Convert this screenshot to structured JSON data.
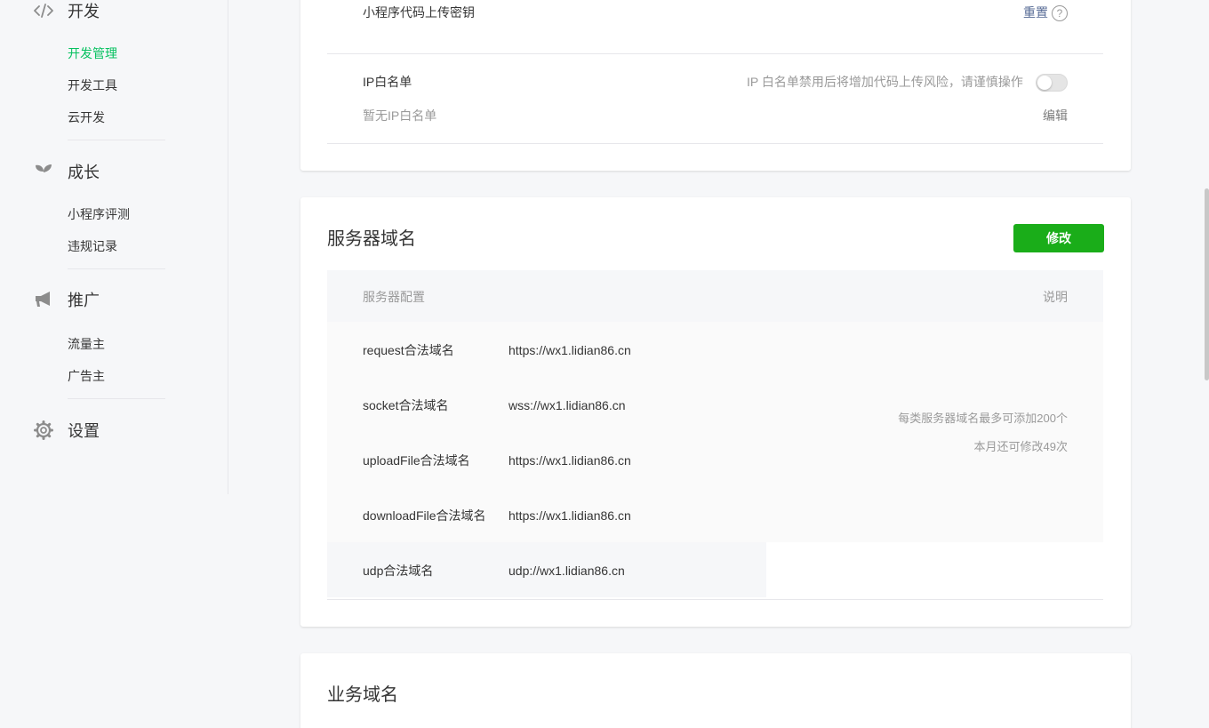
{
  "sidebar": {
    "sections": [
      {
        "title": "开发",
        "icon": "code-icon",
        "items": [
          "开发管理",
          "开发工具",
          "云开发"
        ],
        "active": 0
      },
      {
        "title": "成长",
        "icon": "sprout-icon",
        "items": [
          "小程序评测",
          "违规记录"
        ]
      },
      {
        "title": "推广",
        "icon": "megaphone-icon",
        "items": [
          "流量主",
          "广告主"
        ]
      },
      {
        "title": "设置",
        "icon": "gear-icon",
        "items": []
      }
    ]
  },
  "dev_settings": {
    "upload_key_label": "小程序代码上传密钥",
    "reset_link": "重置",
    "help_glyph": "?",
    "ip_whitelist_label": "IP白名单",
    "ip_whitelist_hint": "IP 白名单禁用后将增加代码上传风险，请谨慎操作",
    "ip_whitelist_enabled": false,
    "ip_whitelist_empty": "暂无IP白名单",
    "edit_link": "编辑"
  },
  "server_domain": {
    "title": "服务器域名",
    "modify_button": "修改",
    "col_config": "服务器配置",
    "col_desc": "说明",
    "rows": [
      {
        "name": "request合法域名",
        "value": "https://wx1.lidian86.cn"
      },
      {
        "name": "socket合法域名",
        "value": "wss://wx1.lidian86.cn"
      },
      {
        "name": "uploadFile合法域名",
        "value": "https://wx1.lidian86.cn"
      },
      {
        "name": "downloadFile合法域名",
        "value": "https://wx1.lidian86.cn"
      },
      {
        "name": "udp合法域名",
        "value": "udp://wx1.lidian86.cn"
      }
    ],
    "desc_line1": "每类服务器域名最多可添加200个",
    "desc_line2": "本月还可修改49次"
  },
  "business_domain": {
    "title": "业务域名"
  },
  "colors": {
    "accent_green": "#07c160",
    "button_green": "#1aad19",
    "link_blue": "#576b95"
  }
}
